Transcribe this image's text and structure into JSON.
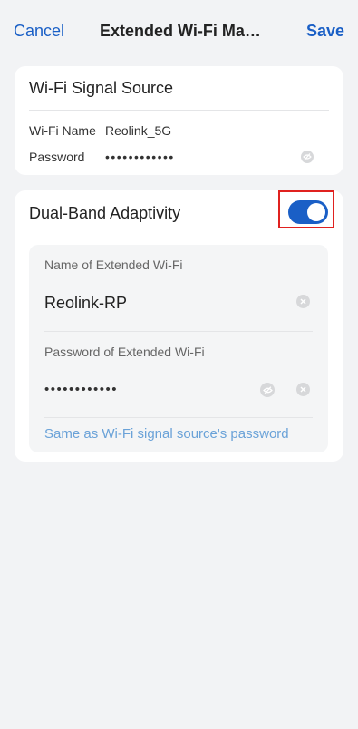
{
  "header": {
    "cancel_label": "Cancel",
    "title": "Extended Wi-Fi Man...",
    "save_label": "Save"
  },
  "source_card": {
    "title": "Wi-Fi Signal Source",
    "wifi_name_label": "Wi-Fi Name",
    "wifi_name_value": "Reolink_5G",
    "password_label": "Password",
    "password_value": "••••••••••••"
  },
  "dual_band": {
    "label": "Dual-Band Adaptivity",
    "enabled": true,
    "extended_name_label": "Name of Extended Wi-Fi",
    "extended_name_value": "Reolink-RP",
    "extended_password_label": "Password of Extended Wi-Fi",
    "extended_password_value": "••••••••••••",
    "same_as_source_link": "Same as Wi-Fi signal source's password"
  },
  "colors": {
    "accent": "#1a5fc6",
    "link": "#6aa2d8",
    "highlight": "#e0211f",
    "background": "#f2f3f5"
  },
  "icons": {
    "visibility_toggle": "eye-off-icon",
    "clear_field": "clear-icon"
  }
}
